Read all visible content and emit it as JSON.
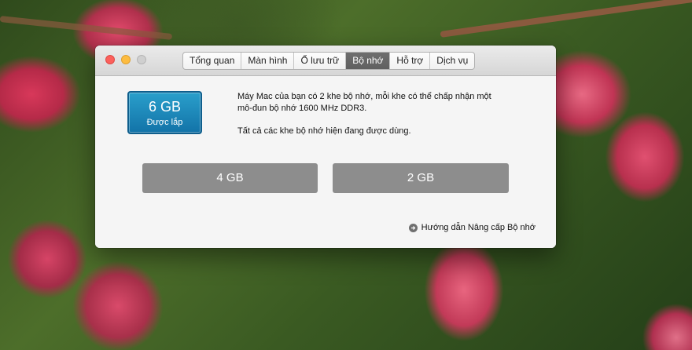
{
  "window": {
    "tabs": [
      {
        "label": "Tổng quan"
      },
      {
        "label": "Màn hình"
      },
      {
        "label": "Ổ lưu trữ"
      },
      {
        "label": "Bộ nhớ"
      },
      {
        "label": "Hỗ trợ"
      },
      {
        "label": "Dịch vụ"
      }
    ],
    "active_tab": "Bộ nhớ"
  },
  "memory": {
    "installed_amount": "6 GB",
    "installed_label": "Được lắp",
    "description": "Máy Mac của bạn có 2 khe bộ nhớ, mỗi khe có thể chấp nhận một mô-đun bộ nhớ 1600 MHz DDR3.",
    "status": "Tất cả các khe bộ nhớ hiện đang được dùng.",
    "slots": [
      {
        "label": "4 GB"
      },
      {
        "label": "2 GB"
      }
    ],
    "upgrade_link": "Hướng dẫn Nâng cấp Bộ nhớ"
  },
  "colors": {
    "accent": "#1d86bb",
    "slot": "#8d8d8d",
    "active_tab": "#666666"
  }
}
